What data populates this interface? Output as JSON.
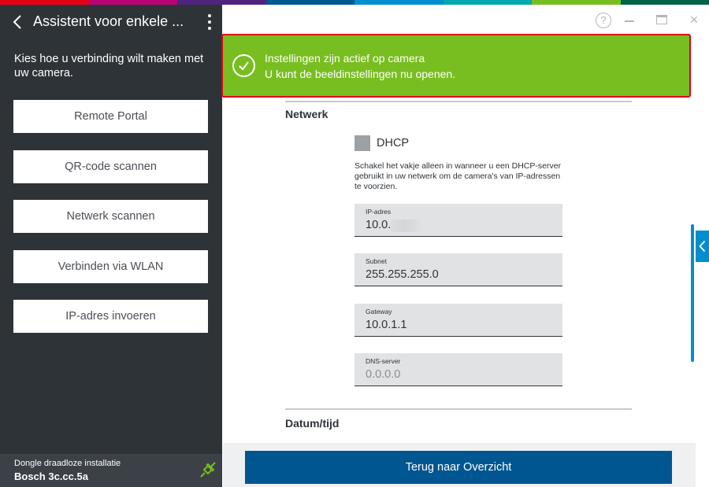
{
  "colors": {
    "sidebar_bg": "#2e3338",
    "success_green": "#78be20",
    "highlight_red": "#e2001a",
    "primary_blue": "#005691",
    "accent_blue": "#008ecf",
    "brand_strip": [
      "#e20015",
      "#b90276",
      "#50237f",
      "#005691",
      "#008ecf",
      "#00a8b0",
      "#78be20",
      "#006249"
    ]
  },
  "sidebar": {
    "back_icon": "chevron-left-icon",
    "title": "Assistent voor enkele ...",
    "menu_icon": "more-vertical-icon",
    "prompt": "Kies hoe u verbinding wilt maken met uw camera.",
    "options": [
      {
        "label": "Remote Portal"
      },
      {
        "label": "QR-code scannen"
      },
      {
        "label": "Netwerk scannen"
      },
      {
        "label": "Verbinden via WLAN"
      },
      {
        "label": "IP-adres invoeren"
      }
    ],
    "footer": {
      "label": "Dongle draadloze installatie",
      "device": "Bosch 3c.cc.5a",
      "icon": "plug-connected-icon"
    }
  },
  "window_controls": {
    "help": "?",
    "close": "×"
  },
  "notification": {
    "icon": "check-circle-icon",
    "line1": "Instellingen zijn actief op camera",
    "line2": "U kunt de beeldinstellingen nu openen."
  },
  "network": {
    "section_title": "Netwerk",
    "dhcp_label": "DHCP",
    "dhcp_checked": false,
    "dhcp_help": "Schakel het vakje alleen in wanneer u een DHCP-server gebruikt in uw netwerk om de camera's van IP-adressen te voorzien.",
    "fields": [
      {
        "label": "IP-adres",
        "value": "10.0."
      },
      {
        "label": "Subnet",
        "value": "255.255.255.0"
      },
      {
        "label": "Gateway",
        "value": "10.0.1.1"
      },
      {
        "label": "DNS-server",
        "value": "0.0.0.0"
      }
    ]
  },
  "datetime": {
    "section_title": "Datum/tijd"
  },
  "footer": {
    "primary_button": "Terug naar Overzicht"
  },
  "side_toggle_icon": "chevron-left-icon"
}
